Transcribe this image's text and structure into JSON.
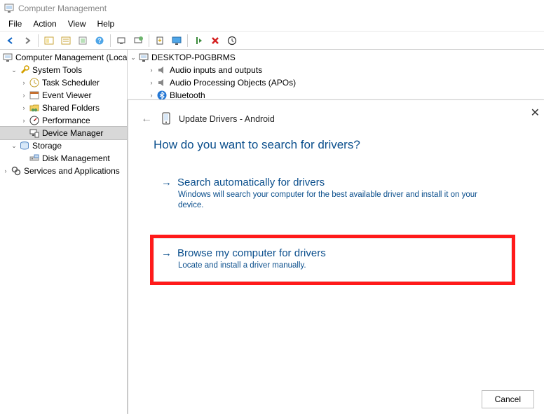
{
  "window": {
    "title": "Computer Management"
  },
  "menubar": {
    "items": [
      "File",
      "Action",
      "View",
      "Help"
    ]
  },
  "left_tree": {
    "root": "Computer Management (Local",
    "system_tools": "System Tools",
    "task_scheduler": "Task Scheduler",
    "event_viewer": "Event Viewer",
    "shared_folders": "Shared Folders",
    "performance": "Performance",
    "device_manager": "Device Manager",
    "storage": "Storage",
    "disk_management": "Disk Management",
    "services_apps": "Services and Applications"
  },
  "right_tree": {
    "computer": "DESKTOP-P0GBRMS",
    "audio_io": "Audio inputs and outputs",
    "audio_apo": "Audio Processing Objects (APOs)",
    "bluetooth": "Bluetooth"
  },
  "dialog": {
    "title": "Update Drivers - Android",
    "question": "How do you want to search for drivers?",
    "opt1_title": "Search automatically for drivers",
    "opt1_desc": "Windows will search your computer for the best available driver and install it on your device.",
    "opt2_title": "Browse my computer for drivers",
    "opt2_desc": "Locate and install a driver manually.",
    "cancel": "Cancel"
  }
}
